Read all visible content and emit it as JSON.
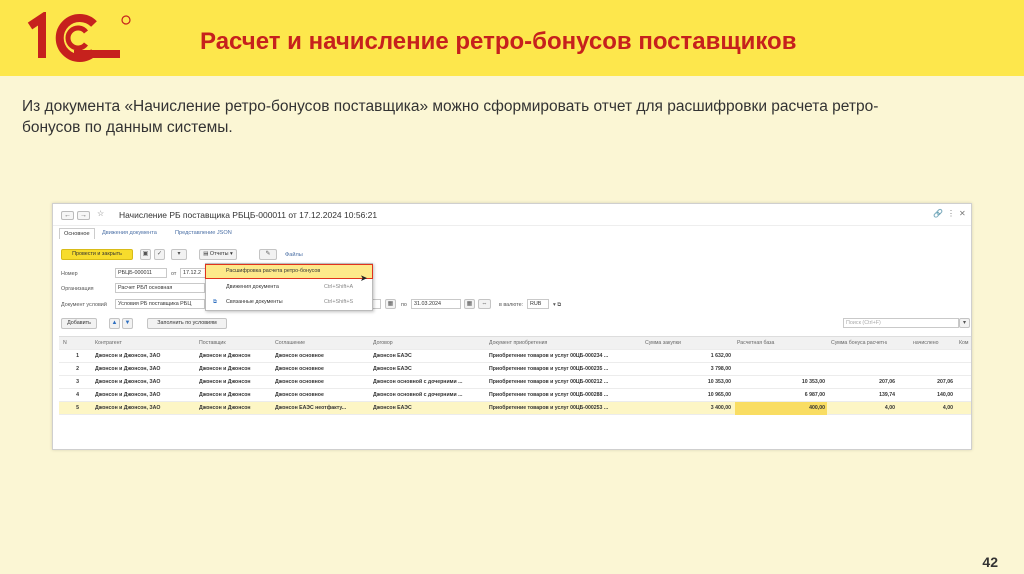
{
  "slide": {
    "logo_text": "1С",
    "title": "Расчет и начисление ретро-бонусов поставщиков",
    "intro": "Из документа «Начисление ретро-бонусов поставщика» можно сформировать отчет для расшифровки расчета ретро-бонусов по данным системы.",
    "page_number": "42"
  },
  "colors": {
    "header": "#fde74c",
    "title": "#c6211d",
    "primary_button": "#f7dc2c",
    "highlight": "#e0331d"
  },
  "window": {
    "back_label": "←",
    "forward_label": "→",
    "title": "Начисление РБ поставщика РБЦБ-000011 от 17.12.2024 10:56:21",
    "tabs": [
      "Основное",
      "Движения документа",
      "Представление JSON"
    ],
    "toolbar": {
      "post_close": "Провести и закрыть",
      "reports": "Отчеты",
      "files": "Файлы"
    },
    "fields": {
      "number_label": "Номер",
      "number_value": "РБЦБ-000011",
      "from_label": "от",
      "from_value": "17.12.2",
      "org_label": "Организация",
      "org_value": "Расчет РБЛ основная",
      "conditions_label": "Документ условий",
      "conditions_value": "Условия РБ поставщика РБЦ",
      "to_label": "по",
      "to_value": "31.03.2024",
      "currency_label": "в валюте:",
      "currency_value": "RUB",
      "search_placeholder": "Поиск (Ctrl+F)"
    },
    "buttons": {
      "add": "Добавить",
      "fill": "Заполнить по условиям"
    },
    "menu": [
      {
        "label": "Расшифровка расчета ретро-бонусов",
        "shortcut": ""
      },
      {
        "label": "Движения документа",
        "shortcut": "Ctrl+Shift+A"
      },
      {
        "label": "Связанные документы",
        "shortcut": "Ctrl+Shift+S"
      }
    ],
    "table": {
      "columns": [
        "N",
        "Контрагент",
        "Поставщик",
        "Соглашение",
        "Договор",
        "Документ приобретения",
        "Сумма закупки",
        "Расчетная база",
        "Сумма бонуса расчетная",
        "начислено",
        "Ком"
      ],
      "rows": [
        [
          "1",
          "Джонсон и Джонсон, ЗАО",
          "Джонсон и Джонсон",
          "Джонсон основное",
          "Джонсон ЕАЭС",
          "Приобретение товаров и услуг 00ЦБ-000234 ...",
          "1 632,00",
          "",
          "",
          "",
          ""
        ],
        [
          "2",
          "Джонсон и Джонсон, ЗАО",
          "Джонсон и Джонсон",
          "Джонсон основное",
          "Джонсон ЕАЭС",
          "Приобретение товаров и услуг 00ЦБ-000235 ...",
          "3 798,00",
          "",
          "",
          "",
          ""
        ],
        [
          "3",
          "Джонсон и Джонсон, ЗАО",
          "Джонсон и Джонсон",
          "Джонсон основное",
          "Джонсон основной с дочерними ...",
          "Приобретение товаров и услуг 00ЦБ-000212 ...",
          "10 353,00",
          "10 353,00",
          "207,06",
          "207,06",
          ""
        ],
        [
          "4",
          "Джонсон и Джонсон, ЗАО",
          "Джонсон и Джонсон",
          "Джонсон основное",
          "Джонсон основной с дочерними ...",
          "Приобретение товаров и услуг 00ЦБ-000288 ...",
          "10 965,00",
          "6 987,00",
          "139,74",
          "140,00",
          ""
        ],
        [
          "5",
          "Джонсон и Джонсон, ЗАО",
          "Джонсон и Джонсон",
          "Джонсон ЕАЭС неотфакту...",
          "Джонсон ЕАЭС",
          "Приобретение товаров и услуг 00ЦБ-000253 ...",
          "3 400,00",
          "400,00",
          "4,00",
          "4,00",
          ""
        ]
      ]
    }
  }
}
